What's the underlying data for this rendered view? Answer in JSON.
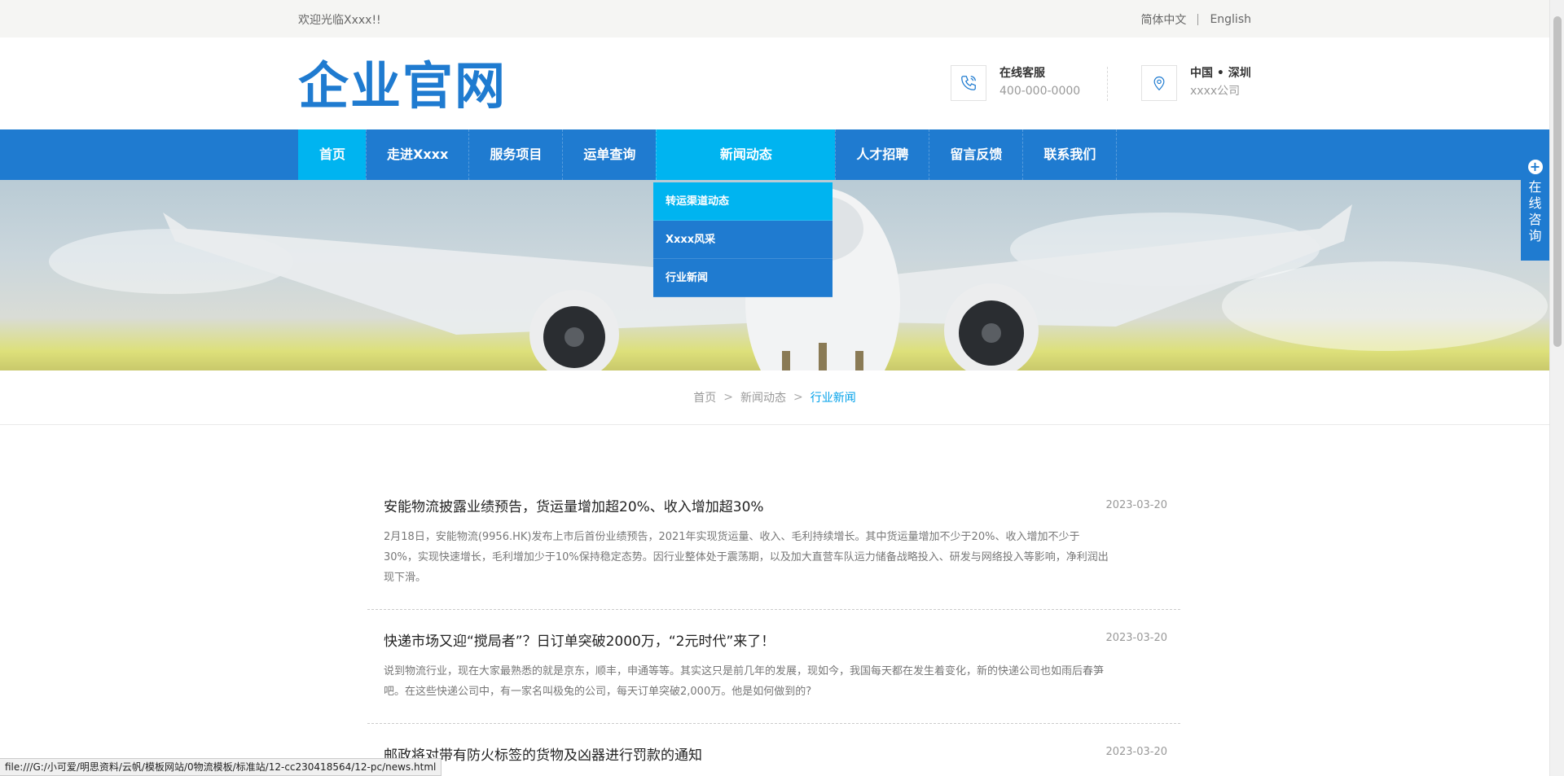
{
  "topbar": {
    "welcome": "欢迎光临Xxxx!!",
    "lang_cn": "简体中文",
    "lang_en": "English"
  },
  "header": {
    "logo": "企业官网",
    "contacts": [
      {
        "icon": "phone-icon",
        "title": "在线客服",
        "value": "400-000-0000"
      },
      {
        "icon": "location-pin-icon",
        "title": "中国 • 深圳",
        "value": "xxxx公司"
      }
    ]
  },
  "nav": {
    "items": [
      {
        "label": "首页"
      },
      {
        "label": "走进Xxxx"
      },
      {
        "label": "服务项目"
      },
      {
        "label": "运单查询"
      },
      {
        "label": "新闻动态"
      },
      {
        "label": "人才招聘"
      },
      {
        "label": "留言反馈"
      },
      {
        "label": "联系我们"
      }
    ],
    "active": "首页",
    "hover": "新闻动态",
    "dropdown": [
      {
        "label": "转运渠道动态"
      },
      {
        "label": "Xxxx风采"
      },
      {
        "label": "行业新闻"
      }
    ]
  },
  "breadcrumb": {
    "home": "首页",
    "section": "新闻动态",
    "current": "行业新闻",
    "separator": ">"
  },
  "news": [
    {
      "title": "安能物流披露业绩预告，货运量增加超20%、收入增加超30%",
      "date": "2023-03-20",
      "desc": "2月18日，安能物流(9956.HK)发布上市后首份业绩预告，2021年实现货运量、收入、毛利持续增长。其中货运量增加不少于20%、收入增加不少于30%，实现快速增长，毛利增加少于10%保持稳定态势。因行业整体处于震荡期，以及加大直营车队运力储备战略投入、研发与网络投入等影响，净利润出现下滑。"
    },
    {
      "title": "快递市场又迎“搅局者”？日订单突破2000万，“2元时代”来了！",
      "date": "2023-03-20",
      "desc": "说到物流行业，现在大家最熟悉的就是京东，顺丰，申通等等。其实这只是前几年的发展，现如今，我国每天都在发生着变化，新的快递公司也如雨后春笋吧。在这些快递公司中，有一家名叫极兔的公司，每天订单突破2,000万。他是如何做到的?"
    },
    {
      "title": "邮政将对带有防火标签的货物及凶器进行罚款的通知",
      "date": "2023-03-20",
      "desc": ""
    }
  ],
  "consult": {
    "label_chars": [
      "在",
      "线",
      "咨",
      "询"
    ]
  },
  "status_bar": {
    "url": "file:///G:/小可爱/明思资料/云帆/模板网站/0物流模板/标准站/12-cc230418564/12-pc/news.html"
  },
  "colors": {
    "primary": "#1f7bd0",
    "accent": "#00b4f0",
    "crumb_current": "#00a0e9"
  }
}
